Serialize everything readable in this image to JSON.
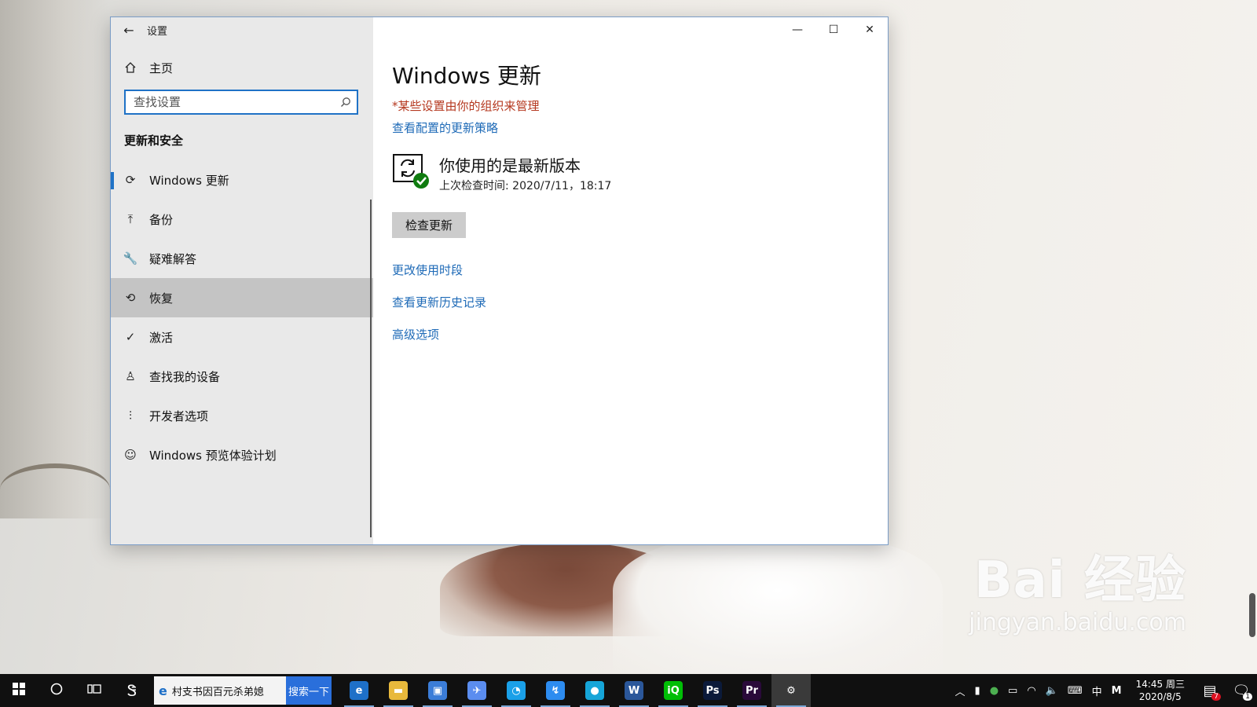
{
  "window": {
    "title": "设置",
    "back_icon": "←",
    "minimize_icon": "—",
    "maximize_icon": "☐",
    "close_icon": "✕"
  },
  "sidebar": {
    "home_label": "主页",
    "search_placeholder": "查找设置",
    "section_title": "更新和安全",
    "items": [
      {
        "label": "Windows 更新",
        "icon": "sync-icon",
        "glyph": "⟳",
        "state": "selected"
      },
      {
        "label": "备份",
        "icon": "backup-icon",
        "glyph": "⤒",
        "state": ""
      },
      {
        "label": "疑难解答",
        "icon": "wrench-icon",
        "glyph": "🔧",
        "state": ""
      },
      {
        "label": "恢复",
        "icon": "history-icon",
        "glyph": "⟲",
        "state": "hovered"
      },
      {
        "label": "激活",
        "icon": "check-circle-icon",
        "glyph": "✓",
        "state": ""
      },
      {
        "label": "查找我的设备",
        "icon": "person-locate-icon",
        "glyph": "♙",
        "state": ""
      },
      {
        "label": "开发者选项",
        "icon": "developer-icon",
        "glyph": "⫶",
        "state": ""
      },
      {
        "label": "Windows 预览体验计划",
        "icon": "insider-icon",
        "glyph": "☺",
        "state": ""
      }
    ]
  },
  "main": {
    "title": "Windows 更新",
    "managed_note": "*某些设置由你的组织来管理",
    "policy_link": "查看配置的更新策略",
    "status_heading": "你使用的是最新版本",
    "status_time": "上次检查时间: 2020/7/11，18:17",
    "check_button": "检查更新",
    "links": [
      "更改使用时段",
      "查看更新历史记录",
      "高级选项"
    ]
  },
  "taskbar": {
    "search_text": "村支书因百元杀弟媳",
    "search_button": "搜索一下",
    "apps": [
      {
        "name": "edge",
        "glyph": "e",
        "color": "#1e70c8"
      },
      {
        "name": "file-explorer",
        "glyph": "▬",
        "color": "#e8b93c"
      },
      {
        "name": "store",
        "glyph": "▣",
        "color": "#3b7dd8"
      },
      {
        "name": "feishu",
        "glyph": "✈",
        "color": "#5b8def"
      },
      {
        "name": "qq-browser",
        "glyph": "◔",
        "color": "#1aa0e8"
      },
      {
        "name": "dingtalk",
        "glyph": "↯",
        "color": "#2d8cf0"
      },
      {
        "name": "qq",
        "glyph": "●",
        "color": "#16a5d8"
      },
      {
        "name": "word",
        "glyph": "W",
        "color": "#2b579a"
      },
      {
        "name": "iqiyi",
        "glyph": "iQ",
        "color": "#00be06"
      },
      {
        "name": "photoshop",
        "glyph": "Ps",
        "color": "#0b1a3a"
      },
      {
        "name": "premiere",
        "glyph": "Pr",
        "color": "#2a0a3a"
      },
      {
        "name": "settings",
        "glyph": "⚙",
        "color": "#3a3a3a"
      }
    ],
    "ime_label": "中",
    "ime_mode": "M",
    "clock_time": "14:45 周三",
    "clock_date": "2020/8/5",
    "notification_count": "7",
    "action_center_count": "1"
  },
  "watermark": {
    "logo": "Bai 经验",
    "url": "jingyan.baidu.com"
  }
}
